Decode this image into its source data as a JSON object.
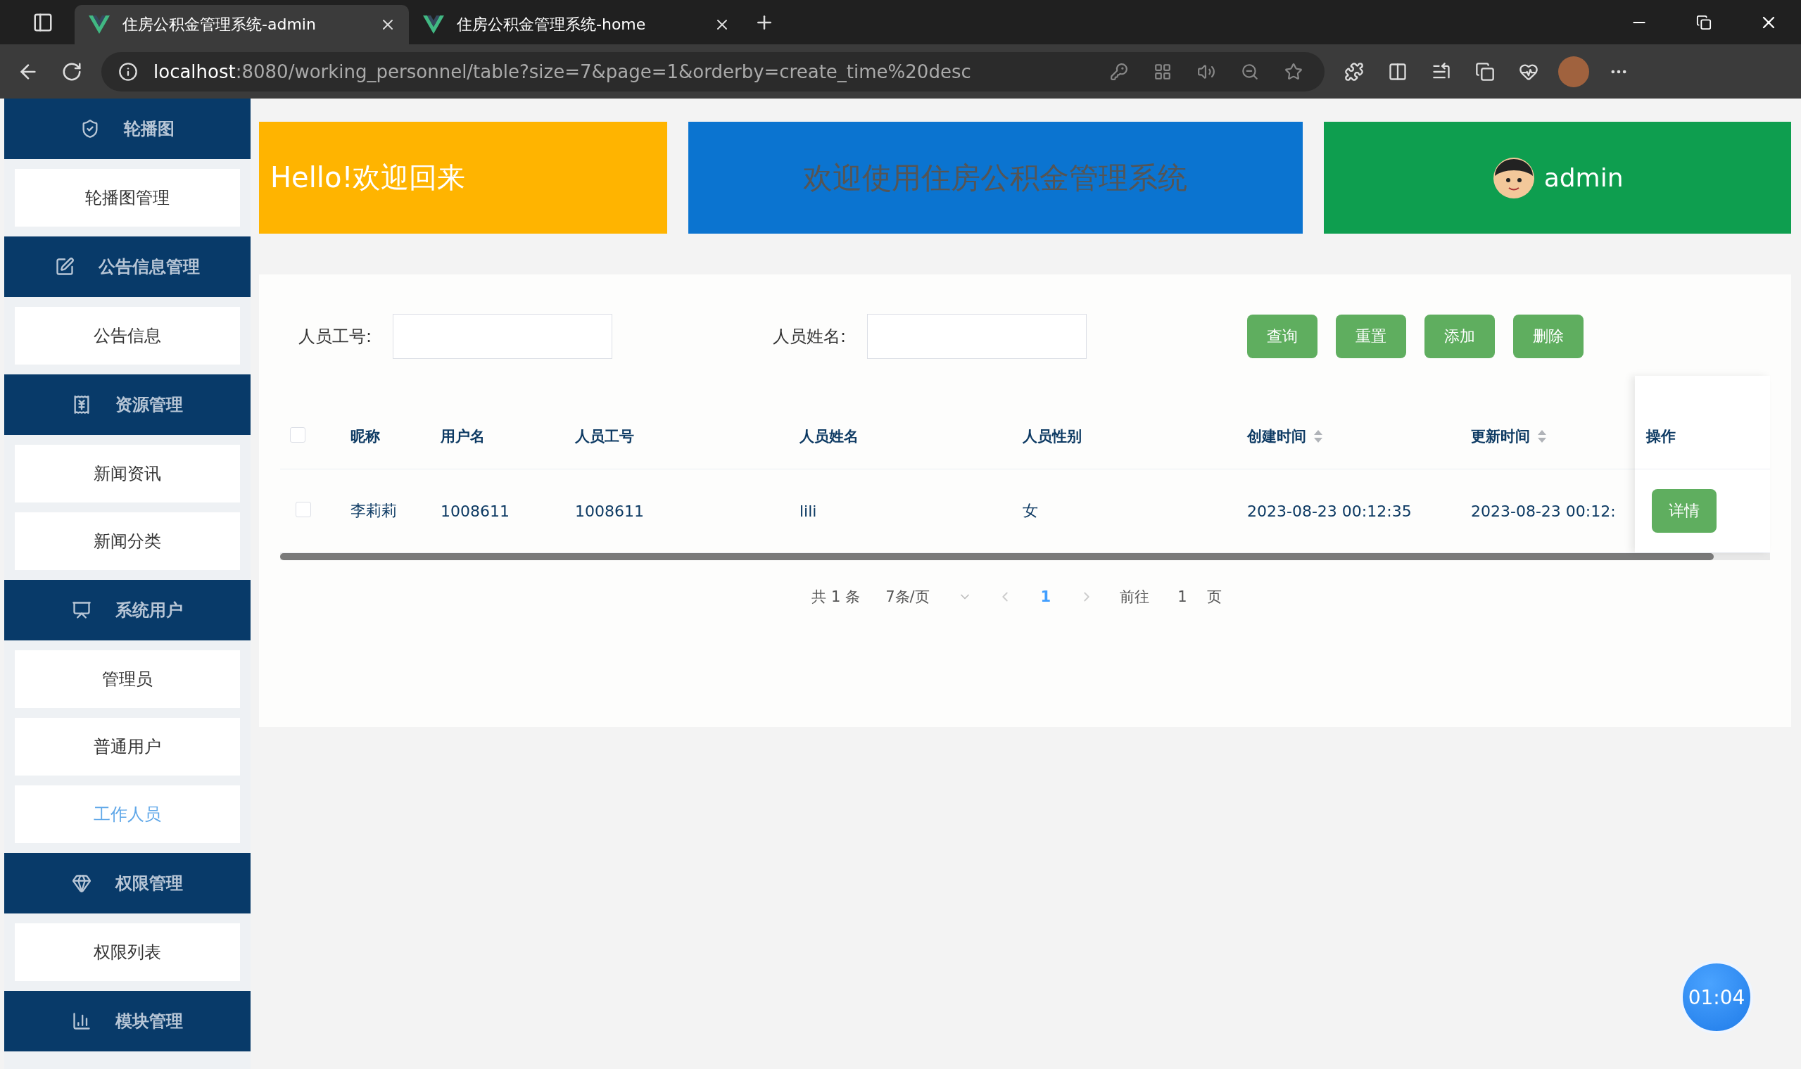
{
  "browser": {
    "tabs": [
      {
        "title": "住房公积金管理系统-admin",
        "selected": true
      },
      {
        "title": "住房公积金管理系统-home",
        "selected": false
      }
    ],
    "url": {
      "host": "localhost",
      "path": ":8080/working_personnel/table?size=7&page=1&orderby=create_time%20desc"
    }
  },
  "sidebar": {
    "groups": [
      {
        "title": "轮播图",
        "items": [
          {
            "label": "轮播图管理",
            "selected": false
          }
        ]
      },
      {
        "title": "公告信息管理",
        "items": [
          {
            "label": "公告信息",
            "selected": false
          }
        ]
      },
      {
        "title": "资源管理",
        "items": [
          {
            "label": "新闻资讯",
            "selected": false
          },
          {
            "label": "新闻分类",
            "selected": false
          }
        ]
      },
      {
        "title": "系统用户",
        "items": [
          {
            "label": "管理员",
            "selected": false
          },
          {
            "label": "普通用户",
            "selected": false
          },
          {
            "label": "工作人员",
            "selected": true
          }
        ]
      },
      {
        "title": "权限管理",
        "items": [
          {
            "label": "权限列表",
            "selected": false
          }
        ]
      },
      {
        "title": "模块管理"
      }
    ]
  },
  "banners": {
    "greeting": "Hello!欢迎回来",
    "welcome": "欢迎使用住房公积金管理系统",
    "user": "admin"
  },
  "search": {
    "fields": [
      {
        "label": "人员工号:"
      },
      {
        "label": "人员姓名:"
      }
    ],
    "buttons": [
      "查询",
      "重置",
      "添加",
      "删除"
    ]
  },
  "table": {
    "select_all": {
      "checked": false
    },
    "columns": [
      {
        "label": "昵称",
        "sortable": false
      },
      {
        "label": "用户名",
        "sortable": false
      },
      {
        "label": "人员工号",
        "sortable": false
      },
      {
        "label": "人员姓名",
        "sortable": false
      },
      {
        "label": "人员性别",
        "sortable": false
      },
      {
        "label": "创建时间",
        "sortable": true
      },
      {
        "label": "更新时间",
        "sortable": true
      }
    ],
    "action_column": "操作",
    "rows": [
      {
        "checked": false,
        "cells": [
          "李莉莉",
          "1008611",
          "1008611",
          "lili",
          "女",
          "2023-08-23 00:12:35",
          "2023-08-23 00:12:"
        ],
        "action": "详情"
      }
    ]
  },
  "pagination": {
    "total": "共 1 条",
    "page_size": "7条/页",
    "pages": [
      {
        "label": "1",
        "selected": true
      }
    ],
    "goto_label": "前往",
    "goto_value": "1",
    "goto_suffix": "页"
  },
  "timer": "01:04"
}
